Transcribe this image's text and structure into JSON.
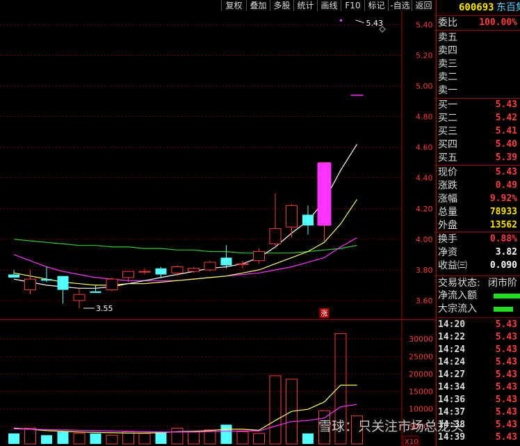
{
  "toolbar": {
    "buttons": [
      "复权",
      "叠加",
      "多股",
      "统计",
      "画线",
      "F10",
      "标记",
      "-自选",
      "返回"
    ]
  },
  "header": {
    "code": "600693",
    "name": "东百集"
  },
  "price_axis": [
    "5.40",
    "5.20",
    "5.00",
    "4.80",
    "4.60",
    "4.40",
    "4.20",
    "4.00",
    "3.80",
    "3.60"
  ],
  "volume_axis": [
    "30000",
    "25000",
    "20000",
    "15000",
    "10000",
    "5000"
  ],
  "volume_unit": "X10",
  "annotations": {
    "high": "5.43",
    "low": "3.55",
    "limit_up": "涨"
  },
  "order_book": {
    "ratio_label": "委比",
    "ratio_value": "100.00%",
    "asks": [
      {
        "label": "卖五"
      },
      {
        "label": "卖四"
      },
      {
        "label": "卖三"
      },
      {
        "label": "卖二"
      },
      {
        "label": "卖一"
      }
    ],
    "bids": [
      {
        "label": "买一",
        "price": "5.43"
      },
      {
        "label": "买二",
        "price": "5.42"
      },
      {
        "label": "买三",
        "price": "5.41"
      },
      {
        "label": "买四",
        "price": "5.40"
      },
      {
        "label": "买五",
        "price": "5.39"
      }
    ]
  },
  "quote": [
    {
      "label": "现价",
      "value": "5.43"
    },
    {
      "label": "涨跌",
      "value": "0.49"
    },
    {
      "label": "涨幅",
      "value": "9.92%"
    },
    {
      "label": "总量",
      "value": "78933"
    },
    {
      "label": "外盘",
      "value": "13562"
    }
  ],
  "fundamentals": [
    {
      "label": "换手",
      "value": "0.88%"
    },
    {
      "label": "净资",
      "value": "3.82"
    },
    {
      "label": "收益㈢",
      "value": "0.090"
    }
  ],
  "status": {
    "trade_status_label": "交易状态:",
    "trade_status_value": "闭市阶",
    "net_inflow_label": "净流入额",
    "block_inflow_label": "大宗流入"
  },
  "ticks": [
    {
      "time": "14:20",
      "price": "5.43"
    },
    {
      "time": "14:22",
      "price": "5.43"
    },
    {
      "time": "14:24",
      "price": "5.43"
    },
    {
      "time": "14:24",
      "price": "5.43"
    },
    {
      "time": "14:27",
      "price": "5.43"
    },
    {
      "time": "14:34",
      "price": "5.43"
    },
    {
      "time": "14:36",
      "price": "5.43"
    },
    {
      "time": "14:37",
      "price": "5.43"
    },
    {
      "time": "14:38",
      "price": "5.43"
    },
    {
      "time": "14:39",
      "price": "5.43"
    }
  ],
  "watermark": "雪球：只关注市场总龙头",
  "colors": {
    "up": "#ff3b3b",
    "down": "#54ffff",
    "limit": "#ff33ff",
    "ma5": "#ffffff",
    "ma10": "#ffff66",
    "ma20": "#ff33ff",
    "ma60": "#33cc33",
    "grid": "#7a0000"
  },
  "chart_data": {
    "type": "candlestick",
    "y_range": [
      3.5,
      5.47
    ],
    "candles": [
      {
        "o": 3.77,
        "h": 3.8,
        "l": 3.75,
        "c": 3.75
      },
      {
        "o": 3.67,
        "h": 3.8,
        "l": 3.64,
        "c": 3.74
      },
      {
        "o": 3.74,
        "h": 3.82,
        "l": 3.72,
        "c": 3.73
      },
      {
        "o": 3.76,
        "h": 3.76,
        "l": 3.58,
        "c": 3.67
      },
      {
        "o": 3.6,
        "h": 3.68,
        "l": 3.55,
        "c": 3.64
      },
      {
        "o": 3.66,
        "h": 3.7,
        "l": 3.65,
        "c": 3.65
      },
      {
        "o": 3.67,
        "h": 3.75,
        "l": 3.66,
        "c": 3.74
      },
      {
        "o": 3.75,
        "h": 3.79,
        "l": 3.72,
        "c": 3.79
      },
      {
        "o": 3.79,
        "h": 3.81,
        "l": 3.77,
        "c": 3.79
      },
      {
        "o": 3.81,
        "h": 3.82,
        "l": 3.75,
        "c": 3.77
      },
      {
        "o": 3.78,
        "h": 3.83,
        "l": 3.76,
        "c": 3.82
      },
      {
        "o": 3.79,
        "h": 3.82,
        "l": 3.78,
        "c": 3.81
      },
      {
        "o": 3.8,
        "h": 3.86,
        "l": 3.79,
        "c": 3.85
      },
      {
        "o": 3.88,
        "h": 3.96,
        "l": 3.81,
        "c": 3.83
      },
      {
        "o": 3.84,
        "h": 3.86,
        "l": 3.81,
        "c": 3.84
      },
      {
        "o": 3.86,
        "h": 3.94,
        "l": 3.84,
        "c": 3.92
      },
      {
        "o": 3.97,
        "h": 4.3,
        "l": 3.94,
        "c": 4.07
      },
      {
        "o": 4.08,
        "h": 4.23,
        "l": 4.01,
        "c": 4.22
      },
      {
        "o": 4.16,
        "h": 4.22,
        "l": 4.03,
        "c": 4.09
      },
      {
        "o": 4.09,
        "h": 4.5,
        "l": 3.99,
        "c": 4.5
      },
      {
        "o": 5.43,
        "h": 5.43,
        "l": 5.43,
        "c": 5.43
      },
      {
        "o": 4.94,
        "h": 4.94,
        "l": 4.94,
        "c": 4.94
      }
    ],
    "ma5": [
      3.74,
      3.72,
      3.7,
      3.69,
      3.68,
      3.68,
      3.69,
      3.71,
      3.73,
      3.75,
      3.77,
      3.79,
      3.81,
      3.82,
      3.84,
      3.88,
      3.95,
      4.04,
      4.12,
      4.25,
      4.45,
      4.62
    ],
    "ma10": [
      3.78,
      3.76,
      3.74,
      3.72,
      3.71,
      3.7,
      3.7,
      3.71,
      3.71,
      3.72,
      3.73,
      3.74,
      3.75,
      3.76,
      3.78,
      3.8,
      3.84,
      3.88,
      3.92,
      3.98,
      4.1,
      4.26
    ],
    "ma20": [
      3.9,
      3.86,
      3.82,
      3.79,
      3.77,
      3.75,
      3.74,
      3.73,
      3.73,
      3.73,
      3.73,
      3.74,
      3.75,
      3.76,
      3.77,
      3.78,
      3.8,
      3.82,
      3.85,
      3.88,
      3.95,
      4.01
    ],
    "ma60": [
      4.0,
      3.99,
      3.98,
      3.97,
      3.96,
      3.96,
      3.95,
      3.95,
      3.94,
      3.94,
      3.93,
      3.93,
      3.92,
      3.92,
      3.91,
      3.91,
      3.91,
      3.91,
      3.92,
      3.93,
      3.94,
      3.96
    ],
    "volume": [
      3000,
      4500,
      2500,
      3500,
      3000,
      3000,
      2500,
      3500,
      3000,
      3500,
      4500,
      3500,
      4000,
      5500,
      3500,
      3000,
      19500,
      18500,
      3000,
      9500,
      31500,
      8000
    ],
    "vol_ma5": [
      4500,
      4200,
      3800,
      3600,
      3400,
      3300,
      3200,
      3100,
      3100,
      3200,
      3500,
      3600,
      3800,
      4200,
      4200,
      3900,
      6700,
      9300,
      9900,
      12000,
      16800,
      16800
    ],
    "vol_ma10": [
      4300,
      4200,
      4100,
      4000,
      3900,
      3800,
      3700,
      3600,
      3500,
      3400,
      3400,
      3400,
      3500,
      3600,
      3700,
      3700,
      5100,
      6400,
      6700,
      7400,
      10600,
      11300
    ]
  }
}
